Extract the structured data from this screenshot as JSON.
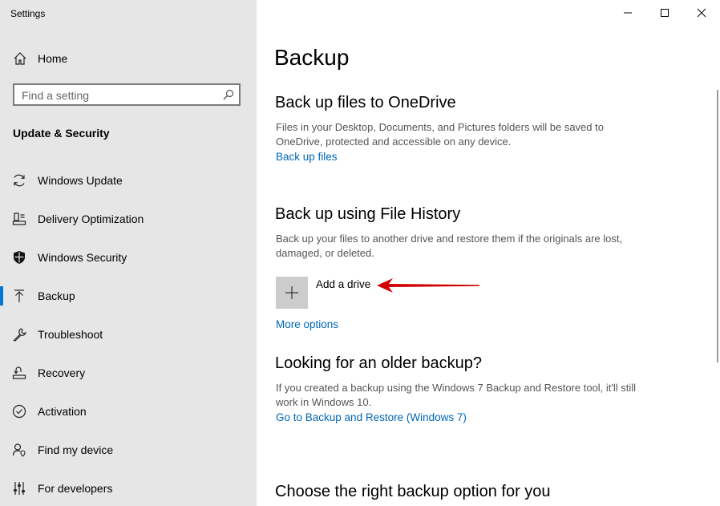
{
  "window": {
    "title": "Settings",
    "controls": [
      "minimize-icon",
      "maximize-icon",
      "close-icon"
    ]
  },
  "sidebar": {
    "home_label": "Home",
    "search": {
      "placeholder": "Find a setting",
      "value": ""
    },
    "section_heading": "Update & Security",
    "items": [
      {
        "label": "Windows Update",
        "icon": "refresh-icon"
      },
      {
        "label": "Delivery Optimization",
        "icon": "delivery-icon"
      },
      {
        "label": "Windows Security",
        "icon": "shield-icon"
      },
      {
        "label": "Backup",
        "icon": "backup-arrow-icon",
        "active": true
      },
      {
        "label": "Troubleshoot",
        "icon": "wrench-icon"
      },
      {
        "label": "Recovery",
        "icon": "recovery-icon"
      },
      {
        "label": "Activation",
        "icon": "check-circle-icon"
      },
      {
        "label": "Find my device",
        "icon": "person-pin-icon"
      },
      {
        "label": "For developers",
        "icon": "developer-sliders-icon"
      }
    ]
  },
  "main": {
    "title": "Backup",
    "onedrive": {
      "heading": "Back up files to OneDrive",
      "description": "Files in your Desktop, Documents, and Pictures folders will be saved to OneDrive, protected and accessible on any device.",
      "link": "Back up files"
    },
    "file_history": {
      "heading": "Back up using File History",
      "description": "Back up your files to another drive and restore them if the originals are lost, damaged, or deleted.",
      "add_drive_label": "Add a drive",
      "more_options": "More options"
    },
    "older_backup": {
      "heading": "Looking for an older backup?",
      "description": "If you created a backup using the Windows 7 Backup and Restore tool, it'll still work in Windows 10.",
      "link": "Go to Backup and Restore (Windows 7)"
    },
    "choose": {
      "heading": "Choose the right backup option for you"
    }
  },
  "colors": {
    "sidebar_bg": "#e6e6e6",
    "accent": "#0078d7",
    "link": "#0067b8",
    "annotation_arrow": "#d10000"
  }
}
